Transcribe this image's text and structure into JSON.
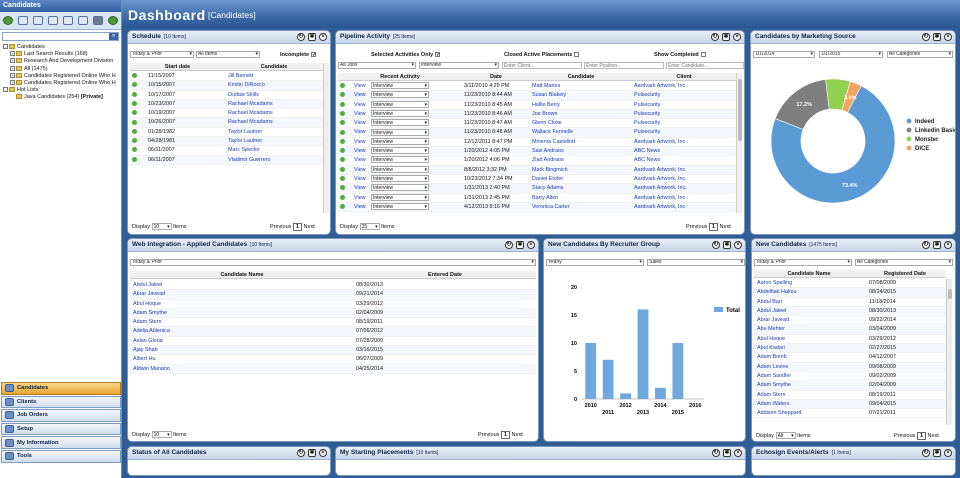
{
  "app": {
    "sidebar_title": "Candidates",
    "page_title": "Dashboard",
    "page_subtitle": "[Candidates]"
  },
  "tree": [
    {
      "label": "Candidates",
      "level": 0,
      "box": "-"
    },
    {
      "label": "Last Search Results (168)",
      "level": 1,
      "box": "+"
    },
    {
      "label": "Research And Development Division",
      "level": 1,
      "box": "+"
    },
    {
      "label": "All (1475)",
      "level": 1,
      "box": "+"
    },
    {
      "label": "Candidates Registered Online Who H",
      "level": 1,
      "box": "+"
    },
    {
      "label": "Candidates Registered Online Who H",
      "level": 1,
      "box": "+"
    },
    {
      "label": "Hot Lists",
      "level": 0,
      "box": "-"
    },
    {
      "label": "Java Candidates (254)",
      "level": 1,
      "box": "",
      "bold_suffix": "[Private]"
    }
  ],
  "nav": [
    {
      "label": "Candidates",
      "active": true
    },
    {
      "label": "Clients",
      "active": false
    },
    {
      "label": "Job Orders",
      "active": false
    },
    {
      "label": "Setup",
      "active": false
    },
    {
      "label": "My Information",
      "active": false
    },
    {
      "label": "Tools",
      "active": false
    }
  ],
  "common": {
    "display": "Display",
    "items": "Items",
    "previous": "Previous",
    "next": "Next",
    "page": "1"
  },
  "schedule": {
    "title": "Schedule",
    "count": "[10 Items]",
    "filter1": "Today & Prior",
    "filter2": "All Items",
    "incomplete_label": "Incomplete",
    "col_date": "Start date",
    "col_candidate": "Candidate",
    "display_count": "10",
    "rows": [
      {
        "date": "11/15/2007",
        "name": "Jill Barnett"
      },
      {
        "date": "10/15/2007",
        "name": "Kristin DiRocco"
      },
      {
        "date": "10/17/2007",
        "name": "Outlaw Skills"
      },
      {
        "date": "10/23/2007",
        "name": "Rachael Mcadams"
      },
      {
        "date": "10/19/2007",
        "name": "Rachael Mcadams"
      },
      {
        "date": "10/26/2007",
        "name": "Rachael Mcadams"
      },
      {
        "date": "01/28/1982",
        "name": "Taylor Lautner"
      },
      {
        "date": "04/28/1981",
        "name": "Taylor Lautner"
      },
      {
        "date": "06/11/2007",
        "name": "Marc Spector"
      },
      {
        "date": "06/11/2007",
        "name": "Vladimir Guerrero"
      }
    ]
  },
  "pipeline": {
    "title": "Pipeline Activity",
    "count": "[25 Items]",
    "opt1": "Selected Activities Only",
    "opt2": "Closed Active Placements",
    "opt3": "Show Completed",
    "f_jobs": "All Jobs",
    "f_status": "Interview",
    "ph_client": "Enter Client...",
    "ph_position": "Enter Position...",
    "ph_candidate": "Enter Candidate...",
    "col_activity": "Recent Activity",
    "col_date": "Date",
    "col_candidate": "Candidate",
    "col_client": "Client",
    "view": "View",
    "status": "Interview",
    "display_count": "25",
    "rows": [
      {
        "date": "3/11/2010 4:29 PM",
        "cand": "Matt Maries",
        "client": "Aardvark Artwork, Inc."
      },
      {
        "date": "11/23/2010 8:44 AM",
        "cand": "Susan Blakely",
        "client": "Pulsecurity"
      },
      {
        "date": "11/23/2010 8:45 AM",
        "cand": "Hallie Berry",
        "client": "Pulsecurity"
      },
      {
        "date": "11/23/2010 8:46 AM",
        "cand": "Joe Brown",
        "client": "Pulsecurity"
      },
      {
        "date": "11/23/2010 8:47 AM",
        "cand": "Glenn Close",
        "client": "Pulsecurity"
      },
      {
        "date": "11/23/2010 8:48 AM",
        "cand": "Wallace Fennelle",
        "client": "Pulsecurity"
      },
      {
        "date": "12/12/2011 8:47 PM",
        "cand": "Minerva Castellott",
        "client": "Aardvark Artwork, Inc."
      },
      {
        "date": "1/20/2012 4:05 PM",
        "cand": "Sasi Andraos",
        "client": "ABC News"
      },
      {
        "date": "1/20/2012 4:06 PM",
        "cand": "Ziad Andraos",
        "client": "ABC News"
      },
      {
        "date": "8/8/2012 3:32 PM",
        "cand": "Mark Bingmich",
        "client": "Aardvark Artwork, Inc."
      },
      {
        "date": "10/23/2012 7:34 PM",
        "cand": "Daniel Etofer",
        "client": "Aardvark Artwork, Inc."
      },
      {
        "date": "1/31/2013 2:40 PM",
        "cand": "Stacy Adams",
        "client": "Aardvark Artwork, Inc."
      },
      {
        "date": "1/31/2013 2:45 PM",
        "cand": "Barry Allen",
        "client": "Aardvark Artwork, Inc."
      },
      {
        "date": "4/12/2013 8:16 PM",
        "cand": "Veronica Carter",
        "client": "Aardvark Artwork, Inc."
      }
    ]
  },
  "marketing": {
    "title": "Candidates by Marketing Source",
    "date_from": "1/1/2014",
    "date_to": "1/1/2015",
    "category": "All Categories",
    "chart_data": {
      "type": "pie",
      "slices": [
        {
          "label": "Indeed",
          "value": 73.4,
          "color": "#5b9bd5"
        },
        {
          "label": "Linkedin Basic",
          "value": 17.2,
          "color": "#7f7f7f"
        },
        {
          "label": "Monster",
          "value": 6.4,
          "color": "#92d050"
        },
        {
          "label": "DICE",
          "value": 3.0,
          "color": "#f4a460"
        }
      ],
      "shown_labels": [
        "73.4%",
        "17.2%",
        "",
        "3.0%"
      ],
      "legend": "right"
    }
  },
  "web": {
    "title": "Web Integration - Applied Candidates",
    "count": "[10 Items]",
    "filter": "Today & Prior",
    "col_name": "Candidate Name",
    "col_date": "Entered Date",
    "display_count": "10",
    "rows": [
      {
        "name": "Abdul Jaleel",
        "date": "08/30/2013"
      },
      {
        "name": "Abrar Javead",
        "date": "09/21/2014"
      },
      {
        "name": "Abul Hoque",
        "date": "03/29/2012"
      },
      {
        "name": "Adam Smythe",
        "date": "02/04/2009"
      },
      {
        "name": "Adam Stern",
        "date": "08/19/2011"
      },
      {
        "name": "Adelia Ablenica",
        "date": "07/06/2012"
      },
      {
        "name": "Aelan Gloria",
        "date": "07/28/2009"
      },
      {
        "name": "Ajay Shah",
        "date": "03/16/2015"
      },
      {
        "name": "Albert Hu",
        "date": "06/07/2009"
      },
      {
        "name": "Aldwin Manano",
        "date": "04/25/2014"
      }
    ]
  },
  "recruiter": {
    "title": "New Candidates By Recruiter Group",
    "period": "Yearly",
    "group": "Sales",
    "chart_data": {
      "type": "bar",
      "categories": [
        "2010",
        "2011",
        "2012",
        "2013",
        "2014",
        "2015",
        "2016"
      ],
      "series": [
        {
          "name": "Total",
          "values": [
            10,
            7,
            1,
            16,
            2,
            10,
            0
          ]
        }
      ],
      "yticks": [
        "0",
        "5",
        "10",
        "15",
        "20"
      ],
      "ylim": [
        0,
        20
      ],
      "legend": "top-right",
      "color": "#6fa8dc"
    }
  },
  "newcand": {
    "title": "New Candidates",
    "count": "[1475 Items]",
    "filter1": "Today & Prior",
    "filter2": "All Categories",
    "col_name": "Candidate Name",
    "col_date": "Registered Date",
    "display_count": "All",
    "rows": [
      {
        "name": "Aaron Spelling",
        "date": "07/08/2009"
      },
      {
        "name": "Abdelhak Hakou",
        "date": "08/24/2015"
      },
      {
        "name": "Abdul Bari",
        "date": "11/18/2014"
      },
      {
        "name": "Abdul Jaleel",
        "date": "08/30/2013"
      },
      {
        "name": "Abrar Javead",
        "date": "09/22/2014"
      },
      {
        "name": "Abu Mehter",
        "date": "03/04/2009"
      },
      {
        "name": "Abul Hoque",
        "date": "03/29/2012"
      },
      {
        "name": "Abul Kadari",
        "date": "02/27/2015"
      },
      {
        "name": "Adam Bomb",
        "date": "04/12/2007"
      },
      {
        "name": "Adam Levine",
        "date": "09/08/2009"
      },
      {
        "name": "Adam Sandler",
        "date": "09/02/2009"
      },
      {
        "name": "Adam Smythe",
        "date": "02/04/2009"
      },
      {
        "name": "Adam Stern",
        "date": "08/19/2011"
      },
      {
        "name": "Adam Waters",
        "date": "09/04/2015"
      },
      {
        "name": "Addison Sheppard",
        "date": "07/21/2011"
      }
    ]
  },
  "bottom": {
    "status_title": "Status of All Candidates",
    "placements_title": "My Starting Placements",
    "placements_count": "[10 Items]",
    "echosign_title": "Echosign Events/Alerts",
    "echosign_count": "[1 Items]"
  }
}
